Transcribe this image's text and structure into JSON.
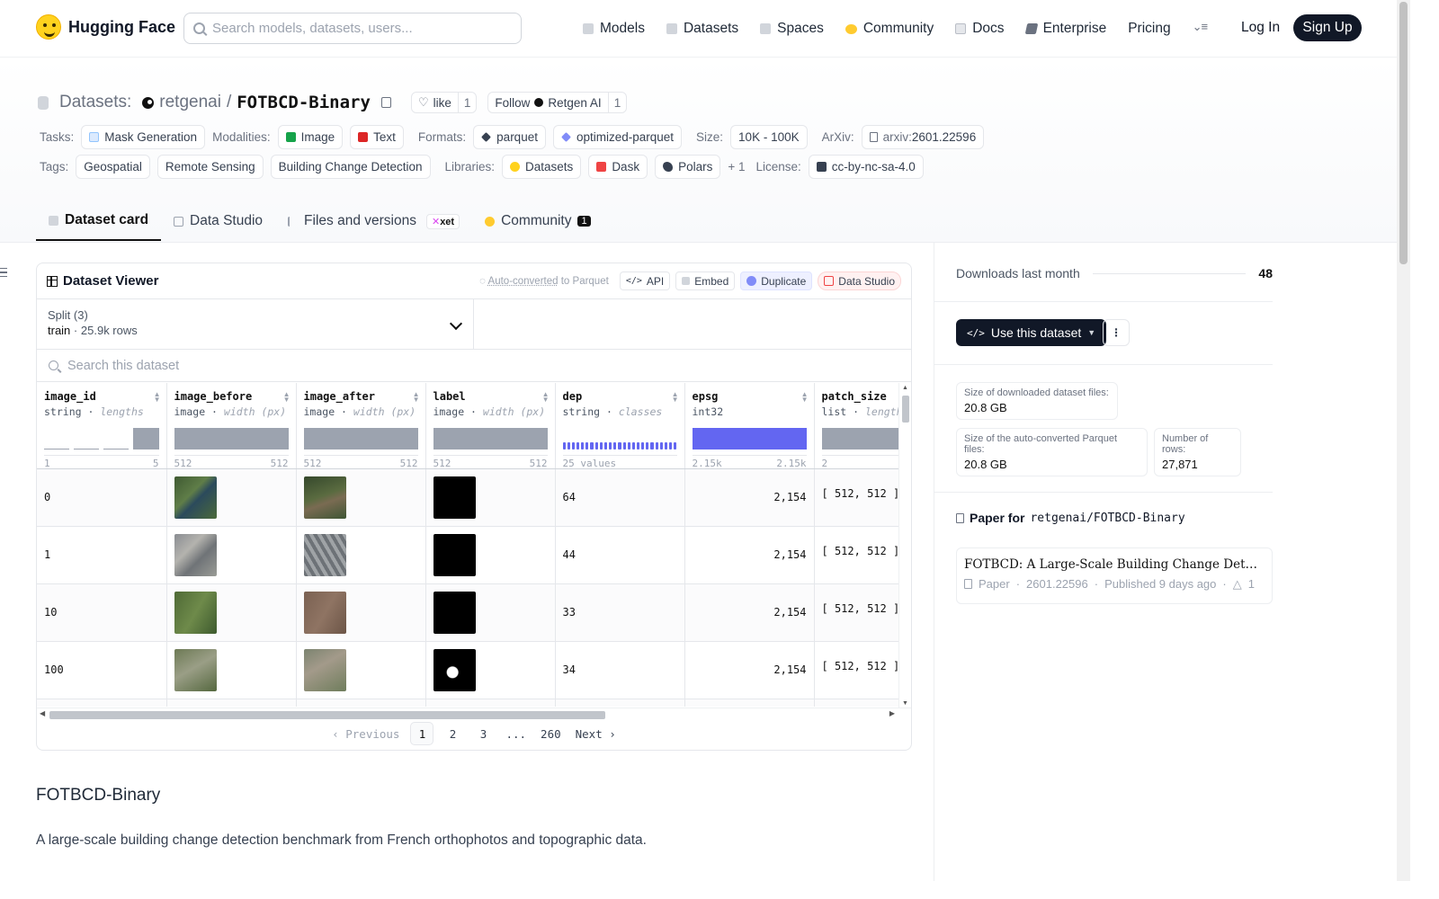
{
  "nav": {
    "brand": "Hugging Face",
    "search_placeholder": "Search models, datasets, users...",
    "links": [
      {
        "label": "Models",
        "icon": "cube-icon"
      },
      {
        "label": "Datasets",
        "icon": "database-icon"
      },
      {
        "label": "Spaces",
        "icon": "spaces-icon"
      },
      {
        "label": "Community",
        "icon": "community-icon"
      },
      {
        "label": "Docs",
        "icon": "book-icon"
      },
      {
        "label": "Enterprise",
        "icon": "enterprise-icon"
      },
      {
        "label": "Pricing"
      }
    ],
    "login": "Log In",
    "signup": "Sign Up"
  },
  "repo": {
    "section": "Datasets:",
    "owner": "retgenai",
    "sep": "/",
    "name": "FOTBCD-Binary",
    "like_label": "like",
    "like_count": "1",
    "follow_label": "Follow",
    "follow_org": "Retgen AI",
    "follow_count": "1"
  },
  "meta": {
    "tasks_label": "Tasks:",
    "task": "Mask Generation",
    "modalities_label": "Modalities:",
    "modalities": [
      "Image",
      "Text"
    ],
    "formats_label": "Formats:",
    "formats": [
      "parquet",
      "optimized-parquet"
    ],
    "size_label": "Size:",
    "size": "10K - 100K",
    "arxiv_label": "ArXiv:",
    "arxiv_prefix": "arxiv:",
    "arxiv": "2601.22596",
    "tags_label": "Tags:",
    "tags": [
      "Geospatial",
      "Remote Sensing",
      "Building Change Detection"
    ],
    "libraries_label": "Libraries:",
    "libraries": [
      "Datasets",
      "Dask",
      "Polars"
    ],
    "libraries_more": "+ 1",
    "license_label": "License:",
    "license": "cc-by-nc-sa-4.0"
  },
  "tabs": [
    {
      "label": "Dataset card",
      "active": true
    },
    {
      "label": "Data Studio"
    },
    {
      "label": "Files and versions",
      "badge": "xet"
    },
    {
      "label": "Community",
      "count": "1"
    }
  ],
  "viewer": {
    "title": "Dataset Viewer",
    "autoconv": "Auto-converted",
    "autoconv_suffix": "to Parquet",
    "api": "API",
    "embed": "Embed",
    "duplicate": "Duplicate",
    "studio": "Data Studio",
    "split_label": "Split (3)",
    "split_value": "train",
    "split_dot": "·",
    "split_rows": "25.9k rows",
    "search_placeholder": "Search this dataset",
    "columns": [
      {
        "name": "image_id",
        "type": "string",
        "sub": "lengths",
        "min": "1",
        "max": "5"
      },
      {
        "name": "image_before",
        "type": "image",
        "sub": "width (px)",
        "min": "512",
        "max": "512"
      },
      {
        "name": "image_after",
        "type": "image",
        "sub": "width (px)",
        "min": "512",
        "max": "512"
      },
      {
        "name": "label",
        "type": "image",
        "sub": "width (px)",
        "min": "512",
        "max": "512"
      },
      {
        "name": "dep",
        "type": "string",
        "sub": "classes",
        "min": "25 values",
        "max": ""
      },
      {
        "name": "epsg",
        "type": "int32",
        "sub": "",
        "min": "2.15k",
        "max": "2.15k"
      },
      {
        "name": "patch_size",
        "type": "list",
        "sub": "lengths",
        "min": "2",
        "max": ""
      }
    ],
    "rows": [
      {
        "image_id": "0",
        "dep": "64",
        "epsg": "2,154",
        "patch_size": "[ 512, 512 ]"
      },
      {
        "image_id": "1",
        "dep": "44",
        "epsg": "2,154",
        "patch_size": "[ 512, 512 ]"
      },
      {
        "image_id": "10",
        "dep": "33",
        "epsg": "2,154",
        "patch_size": "[ 512, 512 ]"
      },
      {
        "image_id": "100",
        "dep": "34",
        "epsg": "2,154",
        "patch_size": "[ 512, 512 ]"
      }
    ],
    "pager": {
      "prev": "Previous",
      "pages": [
        "1",
        "2",
        "3",
        "...",
        "260"
      ],
      "next": "Next"
    }
  },
  "readme": {
    "heading": "FOTBCD-Binary",
    "para": "A large-scale building change detection benchmark from French orthophotos and topographic data."
  },
  "sidebar": {
    "downloads_label": "Downloads last month",
    "downloads": "48",
    "use_dataset": "Use this dataset",
    "dl_size_label": "Size of downloaded dataset files:",
    "dl_size": "20.8 GB",
    "pq_size_label": "Size of the auto-converted Parquet files:",
    "pq_size": "20.8 GB",
    "rows_label": "Number of rows:",
    "rows": "27,871",
    "paper_for": "Paper for",
    "paper_repo": "retgenai/FOTBCD-Binary",
    "paper_title": "FOTBCD: A Large-Scale Building Change Detection Benchmark",
    "paper_kind": "Paper",
    "paper_id": "2601.22596",
    "paper_published": "Published 9 days ago",
    "paper_upvotes": "1"
  },
  "colors": {
    "accent": "#6366f1",
    "dark": "#111827",
    "border": "#e5e7eb"
  }
}
